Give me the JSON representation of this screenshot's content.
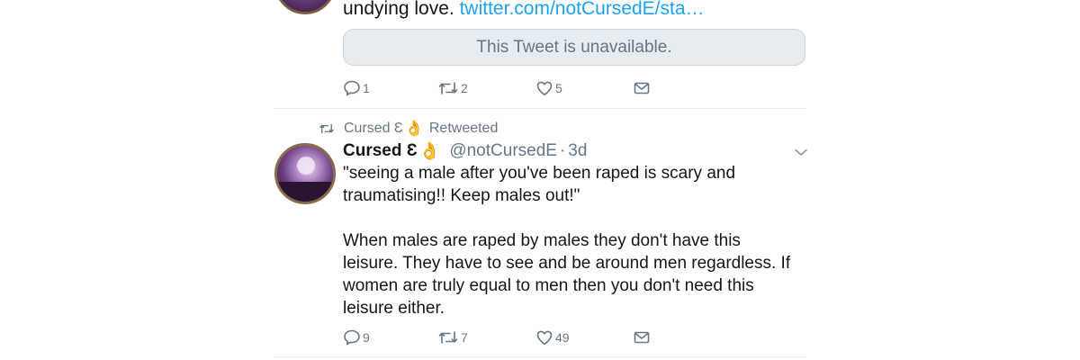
{
  "previous_tweet": {
    "text": "undying love. ",
    "link": "twitter.com/notCursedE/sta…",
    "quoted_unavailable": "This Tweet is unavailable.",
    "actions": {
      "replies": "1",
      "retweets": "2",
      "likes": "5"
    }
  },
  "retweet_context": {
    "name": "Cursed Ɛ",
    "emoji": "👌",
    "label": "Retweeted"
  },
  "tweet": {
    "display_name": "Cursed Ɛ",
    "emoji": "👌",
    "handle": "@notCursedE",
    "separator": "·",
    "time": "3d",
    "body": "\"seeing a male after you've been raped is scary and\ntraumatising!! Keep males out!\"\n\nWhen males are raped by males they don't have this\nleisure. They have to see and be around men regardless. If\nwomen are truly equal to men then you don't need this\nleisure either.",
    "actions": {
      "replies": "9",
      "retweets": "7",
      "likes": "49"
    }
  },
  "icons": {
    "reply": "reply-icon",
    "retweet": "retweet-icon",
    "like": "heart-icon",
    "dm": "envelope-icon",
    "more": "chevron-down-icon"
  },
  "colors": {
    "link": "#1da1f2",
    "secondary_text": "#657786",
    "primary_text": "#14171a",
    "border": "#e6ecf0"
  }
}
